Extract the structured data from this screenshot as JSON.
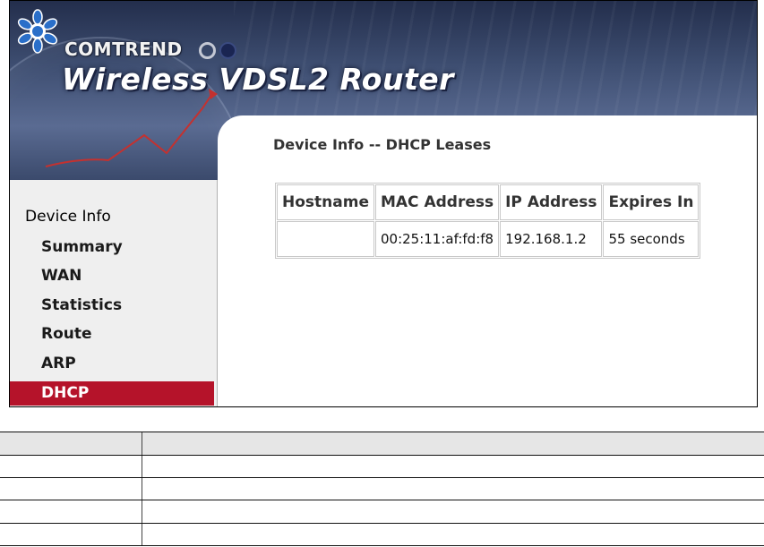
{
  "branding": {
    "logo_text": "COMTREND",
    "product_title": "Wireless VDSL2 Router"
  },
  "sidebar": {
    "header": "Device Info",
    "items": [
      {
        "label": "Summary",
        "active": false
      },
      {
        "label": "WAN",
        "active": false
      },
      {
        "label": "Statistics",
        "active": false
      },
      {
        "label": "Route",
        "active": false
      },
      {
        "label": "ARP",
        "active": false
      },
      {
        "label": "DHCP",
        "active": true
      }
    ]
  },
  "main": {
    "heading": "Device Info -- DHCP Leases",
    "table": {
      "columns": [
        "Hostname",
        "MAC Address",
        "IP Address",
        "Expires In"
      ],
      "rows": [
        [
          "",
          "00:25:11:af:fd:f8",
          "192.168.1.2",
          "55 seconds"
        ]
      ]
    }
  },
  "reference_table": {
    "header": [
      "",
      ""
    ],
    "rows": [
      [
        "",
        ""
      ],
      [
        "",
        ""
      ],
      [
        "",
        ""
      ],
      [
        "",
        ""
      ]
    ]
  },
  "colors": {
    "active_nav": "#b5132a",
    "banner": "#3d4d70",
    "sidebar_bg": "#efefef"
  }
}
